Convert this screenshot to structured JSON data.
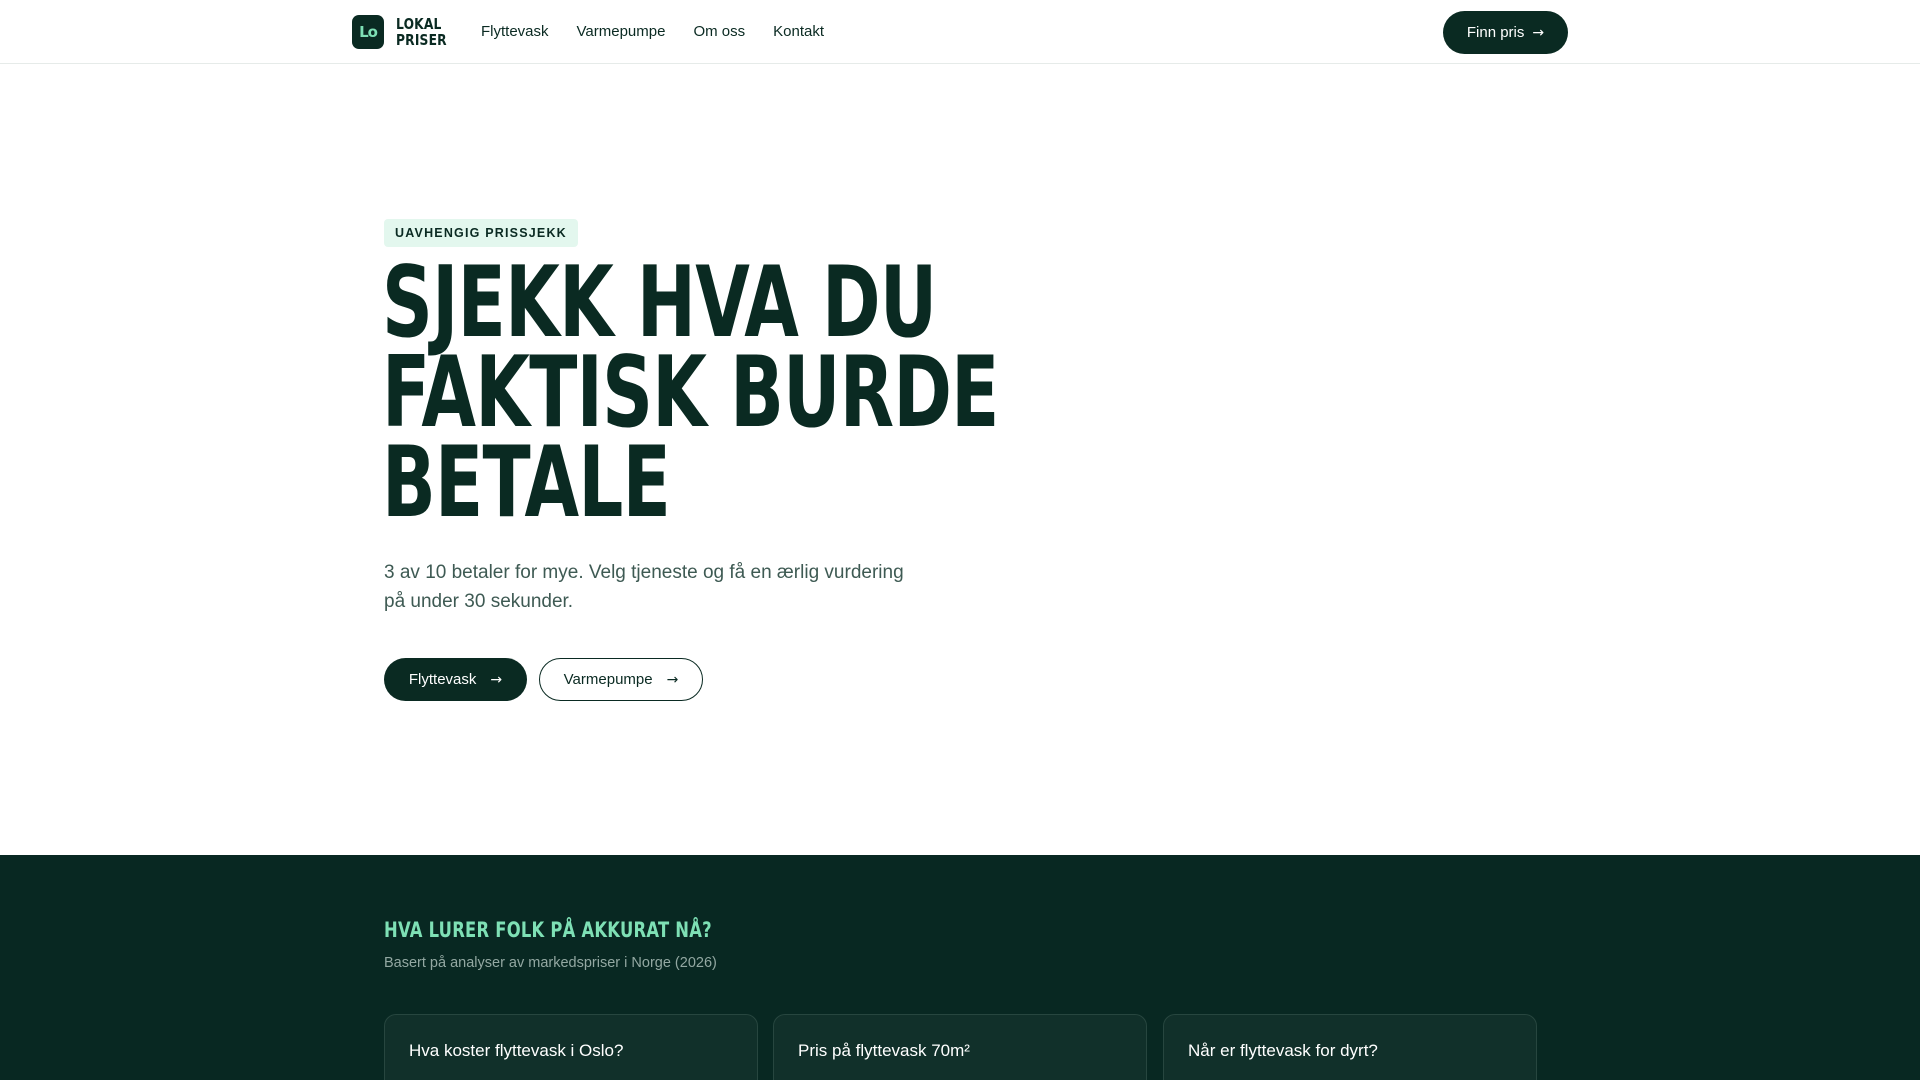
{
  "header": {
    "logo": {
      "line1": "LOKAL",
      "line2": "PRISER",
      "mark": "Lo"
    },
    "nav": [
      "Flyttevask",
      "Varmepumpe",
      "Om oss",
      "Kontakt"
    ],
    "cta": "Finn pris"
  },
  "hero": {
    "badge": "UAVHENGIG PRISSJEKK",
    "title_lines": [
      "SJEKK HVA DU",
      "FAKTISK BURDE",
      "BETALE"
    ],
    "subtitle": "3 av 10 betaler for mye. Velg tjeneste og få en ærlig vurdering på under 30 sekunder.",
    "buttons": {
      "primary": "Flyttevask",
      "secondary": "Varmepumpe"
    }
  },
  "popular": {
    "title": "HVA LURER FOLK PÅ AKKURAT NÅ?",
    "subtitle": "Basert på analyser av markedspriser i Norge (2026)",
    "cards": [
      "Hva koster flyttevask i Oslo?",
      "Pris på flyttevask 70m²",
      "Når er flyttevask for dyrt?"
    ]
  },
  "colors": {
    "brand_dark": "#0a2a22",
    "accent_mint": "#7ee0b5",
    "badge_bg": "#e3f7ee",
    "section_dark": "#082822"
  },
  "icons": {
    "arrow": "arrow-right-icon"
  }
}
